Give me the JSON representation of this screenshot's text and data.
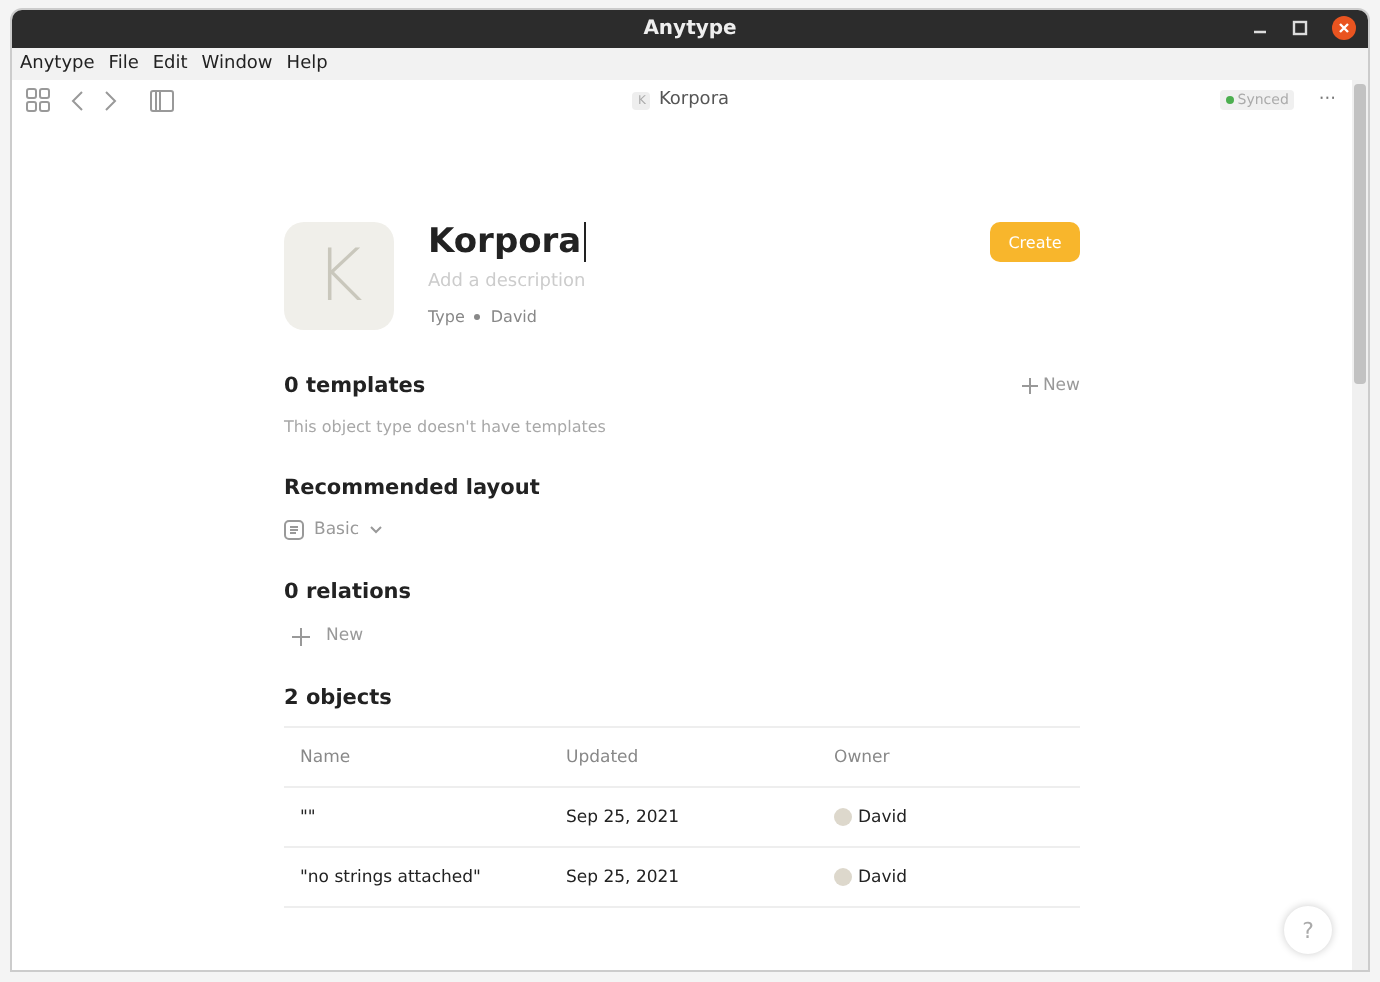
{
  "window": {
    "title": "Anytype"
  },
  "menu": [
    "Anytype",
    "File",
    "Edit",
    "Window",
    "Help"
  ],
  "toolbar": {
    "breadcrumb_icon": "K",
    "breadcrumb": "Korpora",
    "status": "Synced",
    "more": "···"
  },
  "header": {
    "icon_letter": "K",
    "title": "Korpora",
    "description_placeholder": "Add a description",
    "type": "Type",
    "author": "David",
    "create": "Create"
  },
  "templates": {
    "title": "0 templates",
    "new": "New",
    "empty": "This object type doesn't have templates"
  },
  "layout": {
    "title": "Recommended layout",
    "value": "Basic"
  },
  "relations": {
    "title": "0 relations",
    "new": "New"
  },
  "objects": {
    "title": "2 objects",
    "columns": [
      "Name",
      "Updated",
      "Owner"
    ],
    "rows": [
      {
        "name": "\"\"",
        "updated": "Sep 25, 2021",
        "owner": "David"
      },
      {
        "name": "\"no strings attached\"",
        "updated": "Sep 25, 2021",
        "owner": "David"
      }
    ]
  },
  "help": "?"
}
